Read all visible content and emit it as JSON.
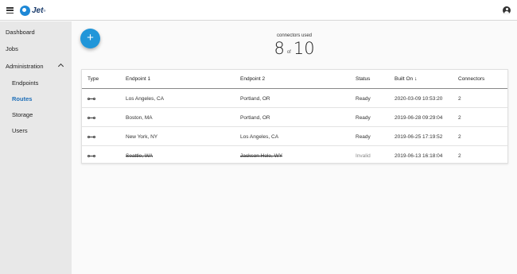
{
  "app": {
    "brand": "Jet",
    "brand_sup": "®"
  },
  "icons": {
    "menu": "hamburger-menu-icon",
    "account": "account-circle-icon",
    "expand": "chevron-up-icon",
    "add": "plus-icon",
    "sort": "arrow-down-icon",
    "route_type": "connector-link-icon"
  },
  "sidebar": {
    "items": [
      {
        "label": "Dashboard"
      },
      {
        "label": "Jobs"
      },
      {
        "label": "Administration"
      },
      {
        "label": "Endpoints"
      },
      {
        "label": "Routes"
      },
      {
        "label": "Storage"
      },
      {
        "label": "Users"
      }
    ],
    "active": "Routes"
  },
  "fab": {
    "label": "+"
  },
  "usage": {
    "label": "connectors used",
    "used": "8",
    "of": "of",
    "total": "10"
  },
  "table": {
    "headers": {
      "type": "Type",
      "endpoint1": "Endpoint 1",
      "endpoint2": "Endpoint 2",
      "status": "Status",
      "built_on": "Built On",
      "sort_arrow": "↓",
      "connectors": "Connectors"
    },
    "rows": [
      {
        "endpoint1": "Los Angeles, CA",
        "endpoint2": "Portland, OR",
        "status": "Ready",
        "built_on": "2020-03-09 10:53:20",
        "connectors": "2"
      },
      {
        "endpoint1": "Boston, MA",
        "endpoint2": "Portland, OR",
        "status": "Ready",
        "built_on": "2019-06-28 09:29:04",
        "connectors": "2"
      },
      {
        "endpoint1": "New York, NY",
        "endpoint2": "Los Angeles, CA",
        "status": "Ready",
        "built_on": "2019-06-25 17:19:52",
        "connectors": "2"
      },
      {
        "endpoint1": "Seattle, WA",
        "endpoint2": "Jackson Hole, WY",
        "status": "Invalid",
        "built_on": "2019-06-13 16:18:04",
        "connectors": "2"
      }
    ]
  },
  "colors": {
    "accent": "#2196d9",
    "active_nav": "#1e6fb8",
    "sidebar_bg": "#e8e8e8"
  }
}
